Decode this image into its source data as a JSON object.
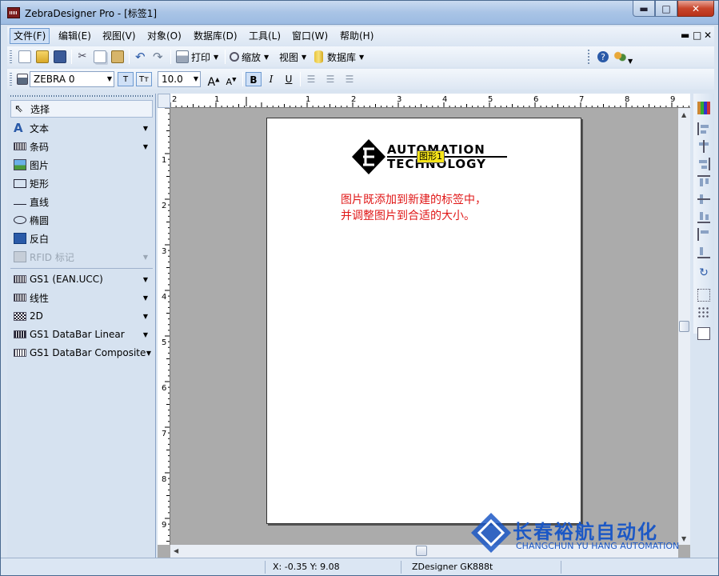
{
  "window": {
    "title": "ZebraDesigner Pro - [标签1]",
    "min_glyph": "▬",
    "max_glyph": "□",
    "close_glyph": "✕"
  },
  "menu": {
    "items": [
      "文件(F)",
      "编辑(E)",
      "视图(V)",
      "对象(O)",
      "数据库(D)",
      "工具(L)",
      "窗口(W)",
      "帮助(H)"
    ],
    "mdi_min": "▬",
    "mdi_max": "□",
    "mdi_close": "✕"
  },
  "toolbar1": {
    "print_label": "打印",
    "zoom_label": "缩放",
    "view_label": "视图",
    "database_label": "数据库"
  },
  "toolbar2": {
    "printer_font": "ZEBRA 0",
    "font_size": "10.0",
    "bold": "B",
    "italic": "I",
    "underline": "U"
  },
  "tools": {
    "select": "选择",
    "text": "文本",
    "barcode": "条码",
    "picture": "图片",
    "rectangle": "矩形",
    "line": "直线",
    "ellipse": "椭圆",
    "inverse": "反白",
    "rfid": "RFID 标记",
    "gs1_ean": "GS1 (EAN.UCC)",
    "linear": "线性",
    "twod": "2D",
    "databar_linear": "GS1 DataBar Linear",
    "databar_composite": "GS1 DataBar Composite"
  },
  "ruler": {
    "h_labels": [
      "2",
      "1",
      "1",
      "2",
      "3",
      "4",
      "5",
      "6",
      "7",
      "8",
      "9"
    ],
    "v_labels": [
      "1",
      "2",
      "3",
      "4",
      "5",
      "6",
      "7",
      "8",
      "9"
    ]
  },
  "label": {
    "logo_line1": "AUTOMATION",
    "logo_line2": "TECHNOLOGY",
    "picture_tag": "图形1",
    "note": "图片既添加到新建的标签中，\n并调整图片到合适的大小。"
  },
  "watermark": {
    "cn": "长春裕航自动化",
    "en": "CHANGCHUN YU HANG AUTOMATION"
  },
  "status": {
    "coords": "X: -0.35 Y:  9.08",
    "printer": "ZDesigner GK888t"
  },
  "colors": {
    "note_red": "#e01818",
    "watermark_blue": "#1c58c5",
    "picture_tag_yellow": "#f6e51a"
  }
}
